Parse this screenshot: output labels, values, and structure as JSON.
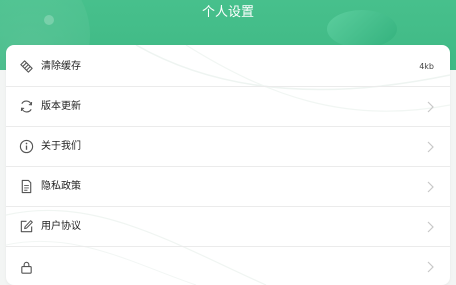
{
  "header": {
    "title": "个人设置"
  },
  "settings": {
    "items": [
      {
        "label": "清除缓存",
        "value": "4kb",
        "icon": "broom-icon"
      },
      {
        "label": "版本更新",
        "icon": "refresh-icon"
      },
      {
        "label": "关于我们",
        "icon": "info-icon"
      },
      {
        "label": "隐私政策",
        "icon": "document-icon"
      },
      {
        "label": "用户协议",
        "icon": "edit-icon"
      }
    ]
  },
  "colors": {
    "header_green": "#47c08c",
    "text": "#222222",
    "icon": "#555555",
    "arrow": "#c8c8c8"
  }
}
